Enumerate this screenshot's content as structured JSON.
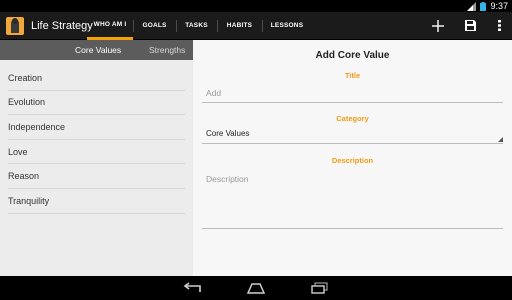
{
  "status_bar": {
    "time": "9:37"
  },
  "action_bar": {
    "app_title": "Life Strategy",
    "tabs": [
      {
        "label": "WHO AM I",
        "active": true
      },
      {
        "label": "GOALS",
        "active": false
      },
      {
        "label": "TASKS",
        "active": false
      },
      {
        "label": "HABITS",
        "active": false
      },
      {
        "label": "LESSONS",
        "active": false
      }
    ],
    "actions": [
      {
        "icon": "add-icon"
      },
      {
        "icon": "save-icon"
      },
      {
        "icon": "overflow-menu-icon"
      }
    ],
    "accent_color": "#f5a10b"
  },
  "left_pane": {
    "subtabs": [
      {
        "label": "Core Values",
        "active": true
      },
      {
        "label": "Strengths",
        "active": false
      }
    ],
    "items": [
      "Creation",
      "Evolution",
      "Independence",
      "Love",
      "Reason",
      "Tranquility"
    ]
  },
  "form": {
    "title": "Add Core Value",
    "title_label": "Title",
    "title_placeholder": "Add",
    "category_label": "Category",
    "category_value": "Core Values",
    "description_label": "Description",
    "description_placeholder": "Description",
    "label_color": "#f39c12"
  },
  "nav_bar": {
    "buttons": [
      "back-icon",
      "home-icon",
      "recent-apps-icon"
    ]
  }
}
